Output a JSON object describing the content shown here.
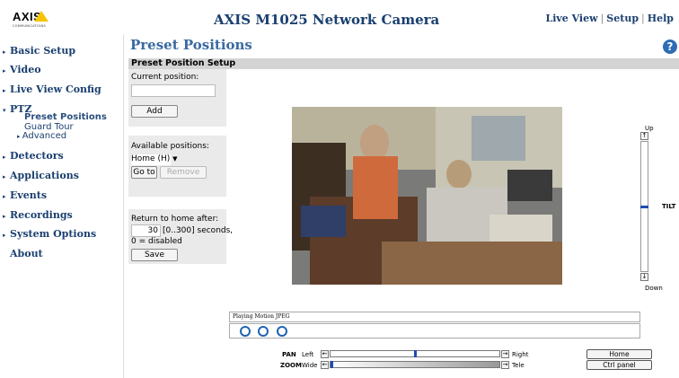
{
  "header": {
    "logo_text": "AXIS",
    "logo_sub": "COMMUNICATIONS",
    "title": "AXIS M1025 Network Camera",
    "links": [
      "Live View",
      "Setup",
      "Help"
    ],
    "brand_yellow": "#f5c400",
    "brand_blue": "#1a3f6f"
  },
  "sidebar": {
    "items": [
      {
        "label": "Basic Setup",
        "icon": "triangle-right-icon"
      },
      {
        "label": "Video",
        "icon": "triangle-right-icon"
      },
      {
        "label": "Live View Config",
        "icon": "triangle-right-icon"
      },
      {
        "label": "PTZ",
        "icon": "triangle-down-icon"
      },
      {
        "label": "Detectors",
        "icon": "triangle-right-icon"
      },
      {
        "label": "Applications",
        "icon": "triangle-right-icon"
      },
      {
        "label": "Events",
        "icon": "triangle-right-icon"
      },
      {
        "label": "Recordings",
        "icon": "triangle-right-icon"
      },
      {
        "label": "System Options",
        "icon": "triangle-right-icon"
      },
      {
        "label": "About",
        "icon": ""
      }
    ],
    "ptz_sub": [
      "Preset Positions",
      "Guard Tour",
      "Advanced"
    ]
  },
  "main": {
    "page_title": "Preset Positions",
    "section_title": "Preset Position Setup",
    "current_position_label": "Current position:",
    "current_position_value": "",
    "add_label": "Add",
    "available_positions_label": "Available positions:",
    "selected_position": "Home (H)",
    "goto_label": "Go to",
    "remove_label": "Remove",
    "return_home_label": "Return to home after:",
    "return_home_value": "30",
    "return_home_hint": "[0..300] seconds,",
    "return_home_hint2": "0 = disabled",
    "save_label": "Save"
  },
  "viewer": {
    "status_text": "Playing Motion JPEG",
    "pan_label": "PAN",
    "pan_left": "Left",
    "pan_right": "Right",
    "pan_level": 0.5,
    "zoom_label": "ZOOM",
    "zoom_wide": "Wide",
    "zoom_tele": "Tele",
    "zoom_level": 0.0,
    "home_label": "Home",
    "ctrl_panel_label": "Ctrl panel",
    "tilt_up": "Up",
    "tilt_down": "Down",
    "tilt_label": "TILT",
    "tilt_level": 0.5
  }
}
